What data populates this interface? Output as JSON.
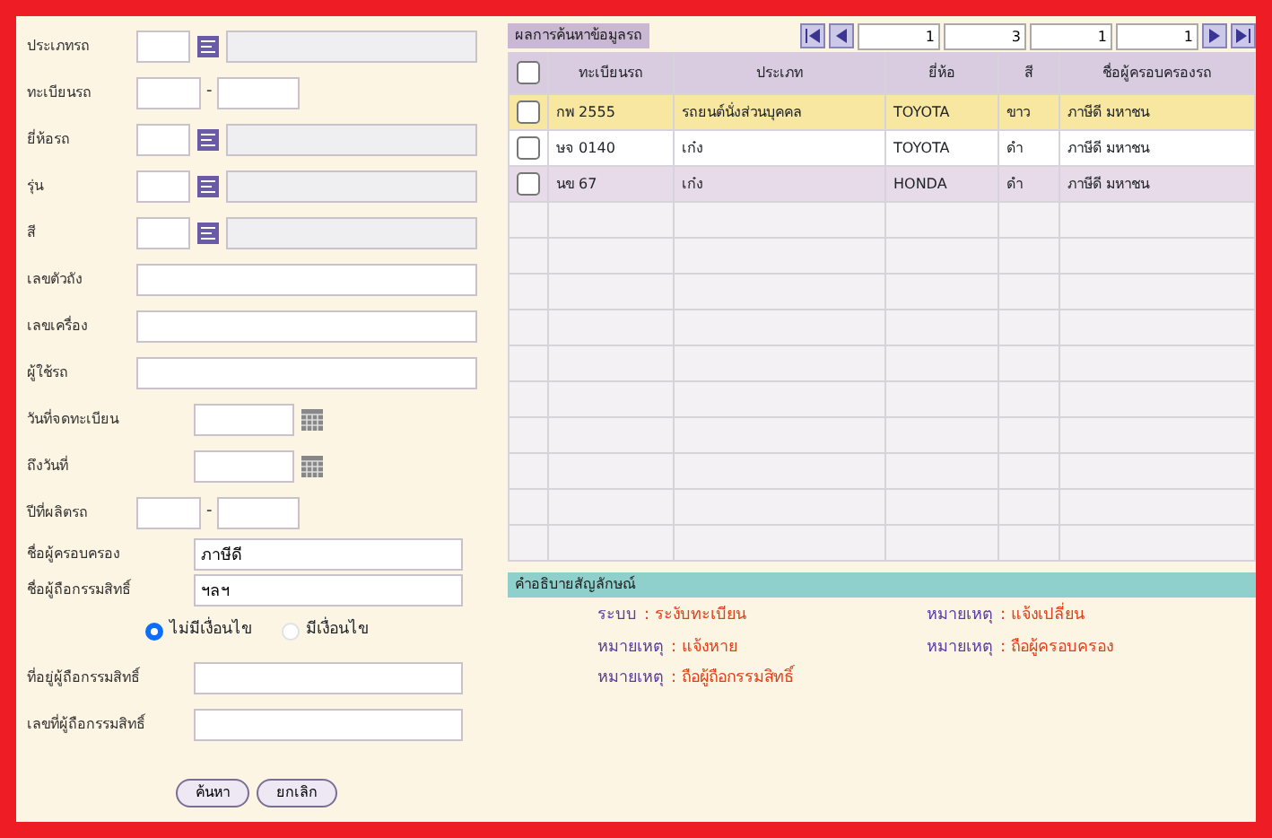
{
  "form": {
    "fields": [
      {
        "kind": "lookup",
        "label": "ประเภทรถ"
      },
      {
        "kind": "range",
        "label": "ทะเบียนรถ",
        "separator": "-"
      },
      {
        "kind": "lookup",
        "label": "ยี่ห้อรถ"
      },
      {
        "kind": "lookup",
        "label": "รุ่น"
      },
      {
        "kind": "lookup",
        "label": "สี"
      },
      {
        "kind": "text",
        "label": "เลขตัวถัง"
      },
      {
        "kind": "text",
        "label": "เลขเครื่อง"
      },
      {
        "kind": "text",
        "label": "ผู้ใช้รถ"
      },
      {
        "kind": "date",
        "label": "วันที่จดทะเบียน"
      },
      {
        "kind": "date",
        "label": "ถึงวันที่"
      },
      {
        "kind": "range",
        "label": "ปีที่ผลิตรถ",
        "separator": "-"
      },
      {
        "kind": "value",
        "label": "ชื่อผู้ครอบครอง",
        "value": "ภาษีดี"
      },
      {
        "kind": "value",
        "label": "ชื่อผู้ถือกรรมสิทธิ์",
        "value": "ฯลฯ"
      }
    ],
    "radios": [
      {
        "label": "ไม่มีเงื่อนไข",
        "selected": true
      },
      {
        "label": "มีเงื่อนไข",
        "selected": false
      }
    ],
    "fields2": [
      {
        "label": "ที่อยู่ผู้ถือกรรมสิทธิ์"
      },
      {
        "label": "เลขที่ผู้ถือกรรมสิทธิ์"
      }
    ],
    "buttons": [
      "ค้นหา",
      "ยกเลิก"
    ]
  },
  "results": {
    "title": "ผลการค้นหาข้อมูลรถ",
    "pager": [
      "1",
      "3",
      "1",
      "1"
    ],
    "select_all": {
      "checked": false
    },
    "columns": [
      "ทะเบียนรถ",
      "ประเภท",
      "ยี่ห้อ",
      "สี",
      "ชื่อผู้ครอบครองรถ"
    ],
    "rows": [
      {
        "highlighted": true,
        "checked": false,
        "cells": [
          "กพ 2555",
          "รถยนต์นั่งส่วนบุคคล",
          "TOYOTA",
          "ขาว",
          "ภาษีดี มหาชน"
        ]
      },
      {
        "highlighted": false,
        "checked": false,
        "cells": [
          "ษจ 0140",
          "เก๋ง",
          "TOYOTA",
          "ดำ",
          "ภาษีดี มหาชน"
        ]
      },
      {
        "highlighted": false,
        "checked": false,
        "cells": [
          "นข 67",
          "เก๋ง",
          "HONDA",
          "ดำ",
          "ภาษีดี มหาชน"
        ]
      }
    ]
  },
  "legend": {
    "title": "คำอธิบายสัญลักษณ์",
    "items": [
      {
        "label": "ระบบ",
        "value": ": ระงับทะเบียน"
      },
      {
        "label": "หมายเหตุ",
        "value": ": แจ้งเปลี่ยน"
      },
      {
        "label": "หมายเหตุ",
        "value": ": แจ้งหาย"
      },
      {
        "label": "หมายเหตุ",
        "value": ": ถือผู้ครอบครอง"
      },
      {
        "label": "หมายเหตุ",
        "value": ": ถือผู้ถือกรรมสิทธิ์"
      }
    ]
  }
}
